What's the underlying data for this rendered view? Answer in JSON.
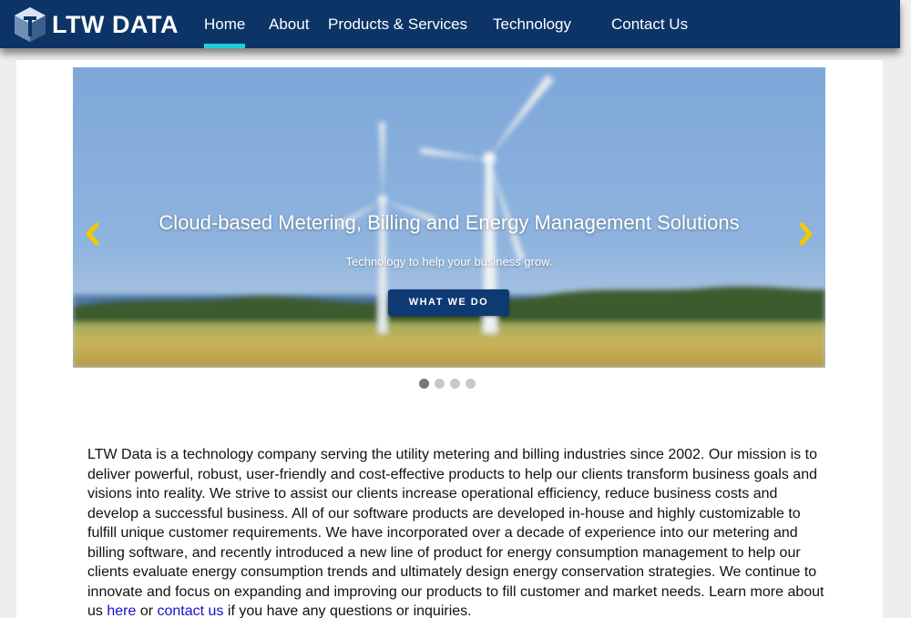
{
  "brand": {
    "name": "LTW DATA"
  },
  "nav": {
    "items": [
      {
        "label": "Home",
        "active": true
      },
      {
        "label": "About"
      },
      {
        "label": "Products & Services"
      },
      {
        "label": "Technology"
      },
      {
        "label": "Contact Us"
      }
    ]
  },
  "carousel": {
    "title": "Cloud-based Metering, Billing and Energy Management Solutions",
    "subtitle": "Technology to help your business grow.",
    "cta_label": "WHAT WE DO",
    "slide_count": 4,
    "active_slide": 1,
    "arrow_color": "#f3c800"
  },
  "intro": {
    "text_before": "LTW Data is a technology company serving the utility metering and billing industries since 2002. Our mission is to deliver powerful, robust, user-friendly and cost-effective products to help our clients transform business goals and visions into reality. We strive to assist our clients increase operational efficiency, reduce business costs and develop a successful business. All of our software products are developed in-house and highly customizable to fulfill unique customer requirements. We have incorporated over a decade of experience into our metering and billing software, and recently introduced a new line of product for energy consumption management to help our clients evaluate energy consumption trends and ultimately design energy conservation strategies. We continue to innovate and focus on expanding and improving our products to fill customer and market needs. Learn more about us ",
    "link_here": "here",
    "text_or": " or ",
    "link_contact": "contact us",
    "text_after": " if you have any questions or inquiries."
  },
  "colors": {
    "navbar": "#0c3466",
    "active_underline": "#18d3dc",
    "link": "#1a0dcc"
  }
}
